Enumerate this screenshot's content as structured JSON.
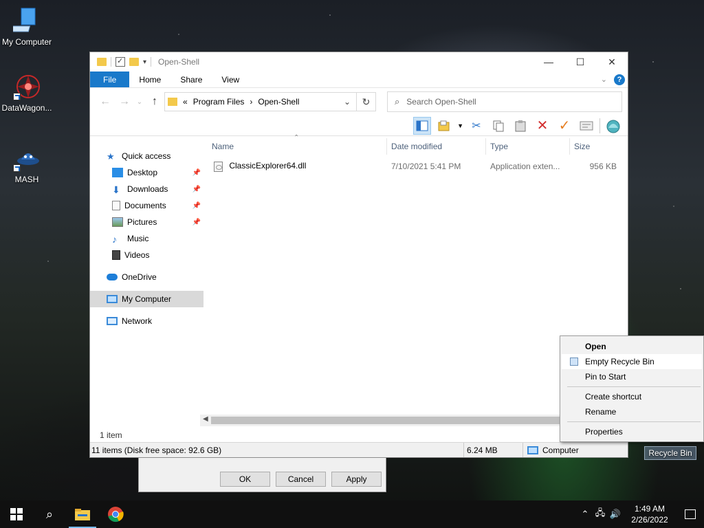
{
  "desktop": {
    "icons": [
      {
        "label": "My Computer",
        "icon": "computer-icon"
      },
      {
        "label": "DataWagon...",
        "icon": "datawagon-icon"
      },
      {
        "label": "MASH",
        "icon": "mash-icon"
      }
    ],
    "recycle_bin_label": "Recycle Bin"
  },
  "back_dialog": {
    "ok": "OK",
    "cancel": "Cancel",
    "apply": "Apply"
  },
  "window": {
    "title": "Open-Shell",
    "ribbon_tabs": [
      "File",
      "Home",
      "Share",
      "View"
    ],
    "help": "?",
    "address": {
      "prefix": "«",
      "segments": [
        "Program Files",
        "Open-Shell"
      ]
    },
    "search_placeholder": "Search Open-Shell",
    "nav": {
      "quick_access": "Quick access",
      "items": [
        {
          "label": "Desktop",
          "icon": "desktop-icon"
        },
        {
          "label": "Downloads",
          "icon": "downloads-icon"
        },
        {
          "label": "Documents",
          "icon": "documents-icon"
        },
        {
          "label": "Pictures",
          "icon": "pictures-icon"
        },
        {
          "label": "Music",
          "icon": "music-icon"
        },
        {
          "label": "Videos",
          "icon": "videos-icon"
        }
      ],
      "onedrive": "OneDrive",
      "my_computer": "My Computer",
      "network": "Network"
    },
    "columns": [
      "Name",
      "Date modified",
      "Type",
      "Size"
    ],
    "files": [
      {
        "name": "ClassicExplorer64.dll",
        "date": "7/10/2021 5:41 PM",
        "type": "Application exten...",
        "size": "956 KB"
      }
    ],
    "item_count": "1 item",
    "status": {
      "items": "11 items (Disk free space: 92.6 GB)",
      "size": "6.24 MB",
      "location": "Computer"
    }
  },
  "context_menu": {
    "items": [
      "Open",
      "Empty Recycle Bin",
      "Pin to Start",
      "Create shortcut",
      "Rename",
      "Properties"
    ]
  },
  "taskbar": {
    "time": "1:49 AM",
    "date": "2/26/2022"
  },
  "colors": {
    "accent": "#1979ca",
    "folder": "#f3c94b",
    "taskbar": "#101010"
  }
}
